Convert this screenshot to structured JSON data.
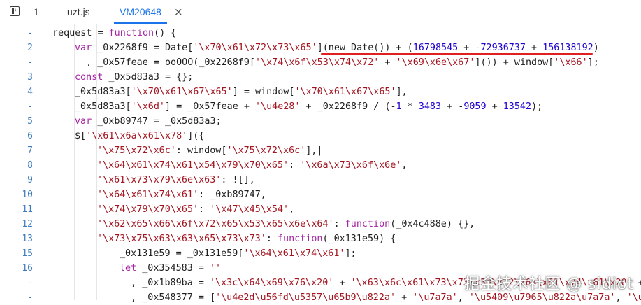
{
  "tabbar": {
    "sidebar_toggle": "sidebar-toggle-icon",
    "tabs": [
      {
        "label": "1"
      },
      {
        "label": "uzt.js"
      },
      {
        "label": "VM20648",
        "active": true,
        "close": "×"
      }
    ]
  },
  "code_lines": [
    {
      "num": "-",
      "indent": 0,
      "tokens": [
        [
          "p",
          "request = "
        ],
        [
          "k",
          "function"
        ],
        [
          "p",
          "() {"
        ]
      ]
    },
    {
      "num": "2",
      "indent": 1,
      "tokens": [
        [
          "k",
          "var"
        ],
        [
          "p",
          " _0x2268f9 = Date["
        ],
        [
          "s",
          "'\\x70\\x61\\x72\\x73\\x65'"
        ],
        [
          "p",
          "](new Date()) + ("
        ],
        [
          "n",
          "16798545"
        ],
        [
          "p",
          " + -"
        ],
        [
          "n",
          "72936737"
        ],
        [
          "p",
          " + "
        ],
        [
          "n",
          "156138192"
        ],
        [
          "p",
          ")"
        ]
      ]
    },
    {
      "num": "-",
      "indent": 1,
      "tokens": [
        [
          "p",
          "  , _0x57feae = ooOOO(_0x2268f9["
        ],
        [
          "s",
          "'\\x74\\x6f\\x53\\x74\\x72'"
        ],
        [
          "p",
          " + "
        ],
        [
          "s",
          "'\\x69\\x6e\\x67'"
        ],
        [
          "p",
          "]()) + window["
        ],
        [
          "s",
          "'\\x66'"
        ],
        [
          "p",
          "];"
        ]
      ]
    },
    {
      "num": "3",
      "indent": 1,
      "tokens": [
        [
          "k",
          "const"
        ],
        [
          "p",
          " _0x5d83a3 = {};"
        ]
      ]
    },
    {
      "num": "4",
      "indent": 1,
      "tokens": [
        [
          "p",
          "_0x5d83a3["
        ],
        [
          "s",
          "'\\x70\\x61\\x67\\x65'"
        ],
        [
          "p",
          "] = window["
        ],
        [
          "s",
          "'\\x70\\x61\\x67\\x65'"
        ],
        [
          "p",
          "],"
        ]
      ]
    },
    {
      "num": "-",
      "indent": 1,
      "tokens": [
        [
          "p",
          "_0x5d83a3["
        ],
        [
          "s",
          "'\\x6d'"
        ],
        [
          "p",
          "] = _0x57feae + "
        ],
        [
          "s",
          "'\\u4e28'"
        ],
        [
          "p",
          " + _0x2268f9 / (-"
        ],
        [
          "n",
          "1"
        ],
        [
          "p",
          " * "
        ],
        [
          "n",
          "3483"
        ],
        [
          "p",
          " + -"
        ],
        [
          "n",
          "9059"
        ],
        [
          "p",
          " + "
        ],
        [
          "n",
          "13542"
        ],
        [
          "p",
          ");"
        ]
      ]
    },
    {
      "num": "5",
      "indent": 1,
      "tokens": [
        [
          "k",
          "var"
        ],
        [
          "p",
          " _0xb89747 = _0x5d83a3;"
        ]
      ]
    },
    {
      "num": "6",
      "indent": 1,
      "tokens": [
        [
          "p",
          "$["
        ],
        [
          "s",
          "'\\x61\\x6a\\x61\\x78'"
        ],
        [
          "p",
          "]({"
        ]
      ]
    },
    {
      "num": "7",
      "indent": 2,
      "tokens": [
        [
          "s",
          "'\\x75\\x72\\x6c'"
        ],
        [
          "p",
          ": window["
        ],
        [
          "s",
          "'\\x75\\x72\\x6c'"
        ],
        [
          "p",
          "],|"
        ]
      ]
    },
    {
      "num": "8",
      "indent": 2,
      "tokens": [
        [
          "s",
          "'\\x64\\x61\\x74\\x61\\x54\\x79\\x70\\x65'"
        ],
        [
          "p",
          ": "
        ],
        [
          "s",
          "'\\x6a\\x73\\x6f\\x6e'"
        ],
        [
          "p",
          ","
        ]
      ]
    },
    {
      "num": "9",
      "indent": 2,
      "tokens": [
        [
          "s",
          "'\\x61\\x73\\x79\\x6e\\x63'"
        ],
        [
          "p",
          ": ![],"
        ]
      ]
    },
    {
      "num": "10",
      "indent": 2,
      "tokens": [
        [
          "s",
          "'\\x64\\x61\\x74\\x61'"
        ],
        [
          "p",
          ": _0xb89747,"
        ]
      ]
    },
    {
      "num": "11",
      "indent": 2,
      "tokens": [
        [
          "s",
          "'\\x74\\x79\\x70\\x65'"
        ],
        [
          "p",
          ": "
        ],
        [
          "s",
          "'\\x47\\x45\\x54'"
        ],
        [
          "p",
          ","
        ]
      ]
    },
    {
      "num": "12",
      "indent": 2,
      "tokens": [
        [
          "s",
          "'\\x62\\x65\\x66\\x6f\\x72\\x65\\x53\\x65\\x6e\\x64'"
        ],
        [
          "p",
          ": "
        ],
        [
          "k",
          "function"
        ],
        [
          "p",
          "(_0x4c488e) {},"
        ]
      ]
    },
    {
      "num": "13",
      "indent": 2,
      "tokens": [
        [
          "s",
          "'\\x73\\x75\\x63\\x63\\x65\\x73\\x73'"
        ],
        [
          "p",
          ": "
        ],
        [
          "k",
          "function"
        ],
        [
          "p",
          "(_0x131e59) {"
        ]
      ]
    },
    {
      "num": "15",
      "indent": 3,
      "tokens": [
        [
          "p",
          "_0x131e59 = _0x131e59["
        ],
        [
          "s",
          "'\\x64\\x61\\x74\\x61'"
        ],
        [
          "p",
          "];"
        ]
      ]
    },
    {
      "num": "16",
      "indent": 3,
      "tokens": [
        [
          "k",
          "let"
        ],
        [
          "p",
          " _0x354583 = "
        ],
        [
          "s",
          "''"
        ]
      ]
    },
    {
      "num": "-",
      "indent": 3,
      "tokens": [
        [
          "p",
          "  , _0x1b89ba = "
        ],
        [
          "s",
          "'\\x3c\\x64\\x69\\x76\\x20'"
        ],
        [
          "p",
          " + "
        ],
        [
          "s",
          "'\\x63\\x6c\\x61\\x73\\x73\\x3d\\x22\\x64\\x61\\x74\\x61\\x20'"
        ],
        [
          "p",
          " + "
        ],
        [
          "s",
          "'\\u"
        ]
      ]
    },
    {
      "num": "-",
      "indent": 3,
      "tokens": [
        [
          "p",
          "  , _0x548377 = ["
        ],
        [
          "s",
          "'\\u4e2d\\u56fd\\u5357\\u65b9\\u822a'"
        ],
        [
          "p",
          " + "
        ],
        [
          "s",
          "'\\u7a7a'"
        ],
        [
          "p",
          ", "
        ],
        [
          "s",
          "'\\u5409\\u7965\\u822a\\u7a7a'"
        ],
        [
          "p",
          ", "
        ],
        [
          "s",
          "'\\u"
        ]
      ]
    }
  ],
  "watermark": "掘金技术社区 @ sidiot",
  "colors": {
    "keyword": "#a626a4",
    "string": "#a3141f",
    "number": "#1c00cf",
    "line_number": "#3e7bbe",
    "active_tab": "#1a73e8",
    "highlight_underline": "#e02020"
  }
}
